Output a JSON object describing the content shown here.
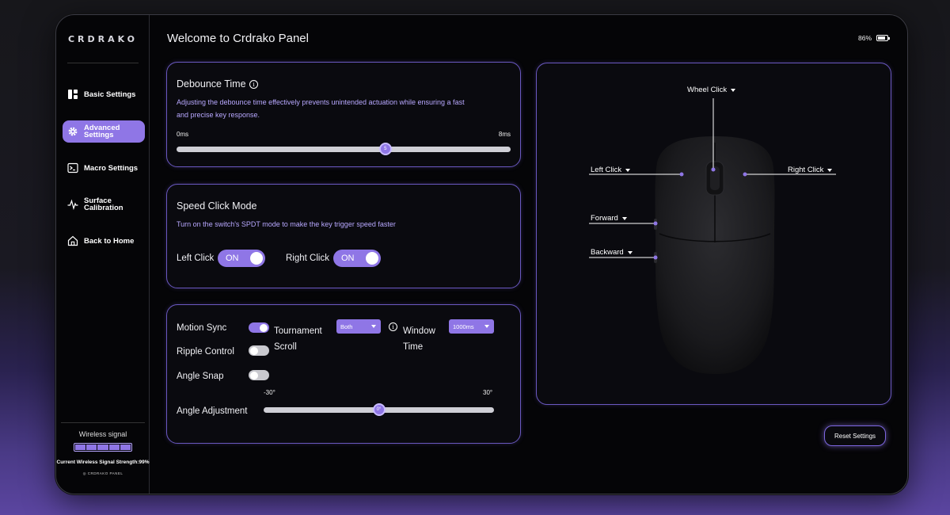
{
  "app": {
    "logo": "CRDRAKO",
    "title": "Welcome to Crdrako Panel",
    "battery": "86%",
    "battery_level": 0.86
  },
  "sidebar": {
    "items": [
      {
        "label": "Basic Settings",
        "icon": "grid-icon"
      },
      {
        "label": "Advanced Settings",
        "icon": "gear-icon"
      },
      {
        "label": "Macro Settings",
        "icon": "terminal-icon"
      },
      {
        "label": "Surface Calibration",
        "icon": "pulse-icon"
      },
      {
        "label": "Back to Home",
        "icon": "home-icon"
      }
    ],
    "signal_title": "Wireless signal",
    "signal_strength": "Current Wireless Signal Strength:99%",
    "brand_small": "CRDRAKO PANEL"
  },
  "debounce": {
    "title": "Debounce Time",
    "desc_line1": "Adjusting the debounce time effectively prevents unintended actuation while ensuring a fast",
    "desc_line2": "and precise key response.",
    "min": "0ms",
    "max": "8ms",
    "value": "5",
    "value_num": 5
  },
  "speed_click": {
    "title": "Speed Click Mode",
    "desc": "Turn on the switch's SPDT mode to make the key trigger speed faster",
    "left_label": "Left Click",
    "left_state": "ON",
    "right_label": "Right Click",
    "right_state": "ON"
  },
  "motion": {
    "motion_sync": "Motion Sync",
    "tournament_line1": "Tournament",
    "tournament_line2": "Scroll",
    "tournament_value": "Both",
    "window_line1": "Window",
    "window_line2": "Time",
    "window_value": "1000ms",
    "ripple": "Ripple Control",
    "angle_snap": "Angle Snap",
    "angle_adjust": "Angle Adjustment",
    "angle_min": "-30°",
    "angle_max": "30°",
    "angle_value": "0°",
    "angle_num": 0
  },
  "mouse": {
    "wheel": "Wheel Click",
    "left": "Left Click",
    "right": "Right Click",
    "forward": "Forward",
    "backward": "Backward"
  },
  "reset": "Reset Settings",
  "colors": {
    "accent": "#8f76e6",
    "border": "#6a58c0",
    "desc": "#b8a8ff"
  }
}
